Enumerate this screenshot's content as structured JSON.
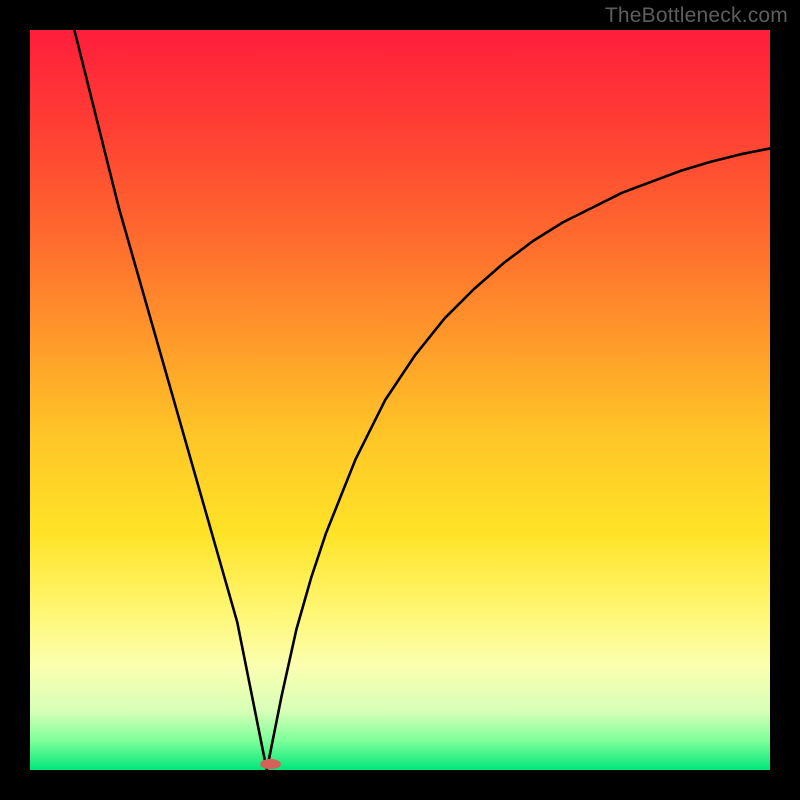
{
  "watermark": "TheBottleneck.com",
  "chart_data": {
    "type": "line",
    "title": "",
    "xlabel": "",
    "ylabel": "",
    "xlim": [
      0,
      100
    ],
    "ylim": [
      0,
      100
    ],
    "grid": false,
    "dip": {
      "x": 32,
      "y": 0
    },
    "marker": {
      "x": 32.5,
      "y": 0.8,
      "color": "#d6605a"
    },
    "series": [
      {
        "name": "curve",
        "color": "#000000",
        "x": [
          6,
          8,
          10,
          12,
          14,
          16,
          18,
          20,
          22,
          24,
          26,
          28,
          30,
          31,
          32,
          33,
          34,
          36,
          38,
          40,
          44,
          48,
          52,
          56,
          60,
          64,
          68,
          72,
          76,
          80,
          84,
          88,
          92,
          96,
          100
        ],
        "y": [
          100,
          92,
          84,
          76,
          69,
          62,
          55,
          48,
          41,
          34,
          27,
          20,
          10,
          5,
          0,
          5,
          10,
          19,
          26,
          32,
          42,
          50,
          56,
          61,
          65,
          68.5,
          71.5,
          74,
          76,
          78,
          79.5,
          81,
          82.2,
          83.2,
          84
        ]
      }
    ],
    "background_gradient": {
      "orientation": "vertical",
      "stops": [
        {
          "pos": 0.0,
          "color": "#ff1e3c"
        },
        {
          "pos": 0.28,
          "color": "#ff6a2e"
        },
        {
          "pos": 0.55,
          "color": "#ffc627"
        },
        {
          "pos": 0.78,
          "color": "#fff66f"
        },
        {
          "pos": 0.92,
          "color": "#d8ffb8"
        },
        {
          "pos": 1.0,
          "color": "#00e77a"
        }
      ]
    }
  }
}
